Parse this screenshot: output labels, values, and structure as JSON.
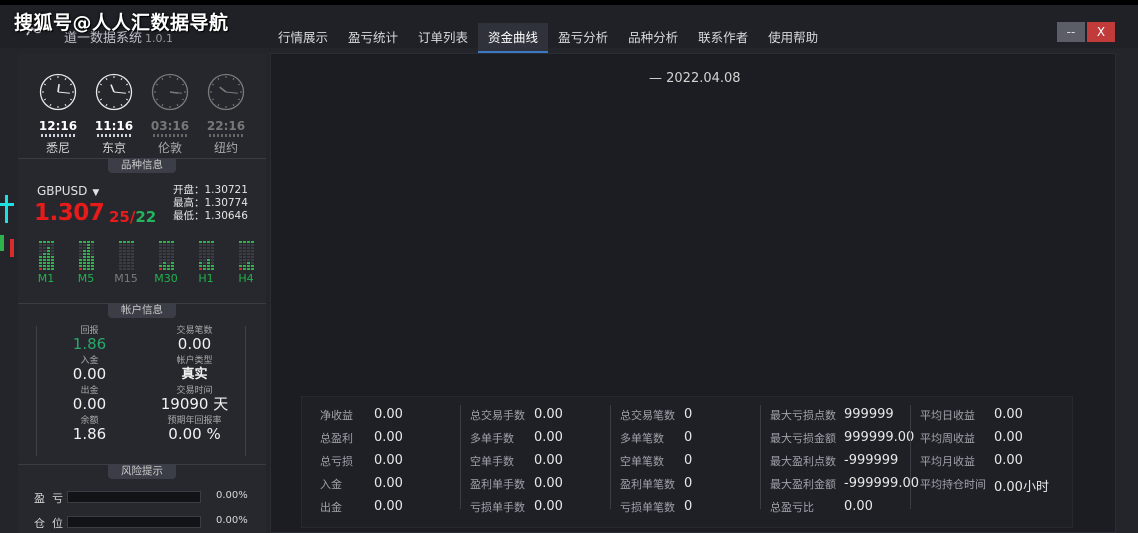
{
  "overlay": {
    "watermark": "搜狐号@人人汇数据导航"
  },
  "app": {
    "title": "道一数据系统",
    "version": "1.0.1"
  },
  "nav": {
    "tabs": [
      "行情展示",
      "盈亏统计",
      "订单列表",
      "资金曲线",
      "盈亏分析",
      "品种分析",
      "联系作者",
      "使用帮助"
    ],
    "active_index": 3
  },
  "window_controls": {
    "minimize": "--",
    "close": "X"
  },
  "clocks": [
    {
      "time": "12:16",
      "city": "悉尼",
      "active": true
    },
    {
      "time": "11:16",
      "city": "东京",
      "active": true
    },
    {
      "time": "03:16",
      "city": "伦敦",
      "active": false
    },
    {
      "time": "22:16",
      "city": "纽约",
      "active": false
    }
  ],
  "symbol": {
    "section_title": "品种信息",
    "name": "GBPUSD",
    "caret": "▼",
    "price_main": "1.307",
    "price_digits_a": "25",
    "price_sep": "/",
    "price_digits_b": "22",
    "open": "开盘：1.30721",
    "high": "最高：1.30774",
    "low": "最低：1.30646",
    "timeframes": [
      {
        "label": "M1",
        "active": true,
        "level": [
          5,
          6,
          8,
          5
        ]
      },
      {
        "label": "M5",
        "active": true,
        "level": [
          4,
          7,
          9,
          5
        ]
      },
      {
        "label": "M15",
        "active": false,
        "level": [
          0,
          0,
          0,
          0
        ]
      },
      {
        "label": "M30",
        "active": true,
        "level": [
          2,
          3,
          2,
          3
        ]
      },
      {
        "label": "H1",
        "active": true,
        "level": [
          3,
          2,
          4,
          2
        ]
      },
      {
        "label": "H4",
        "active": true,
        "level": [
          2,
          2,
          3,
          2
        ]
      }
    ]
  },
  "account": {
    "section_title": "帐户信息",
    "left": [
      {
        "label": "回报",
        "value": "1.86",
        "style": "green"
      },
      {
        "label": "入金",
        "value": "0.00",
        "style": ""
      },
      {
        "label": "出金",
        "value": "0.00",
        "style": ""
      },
      {
        "label": "余额",
        "value": "1.86",
        "style": ""
      }
    ],
    "right": [
      {
        "label": "交易笔数",
        "value": "0.00",
        "style": ""
      },
      {
        "label": "帐户类型",
        "value": "真实",
        "style": "strong"
      },
      {
        "label": "交易时间",
        "value": "19090 天",
        "style": ""
      },
      {
        "label": "预期年回报率",
        "value": "0.00 %",
        "style": ""
      }
    ]
  },
  "risk": {
    "section_title": "风险提示",
    "rows": [
      {
        "label": "盈亏",
        "value": "0.00%",
        "fraction": 0
      },
      {
        "label": "仓位",
        "value": "0.00%",
        "fraction": 0
      }
    ]
  },
  "chart": {
    "legend": "— 2022.04.08"
  },
  "stats": {
    "columns": [
      {
        "rows": [
          {
            "label": "净收益",
            "value": "0.00"
          },
          {
            "label": "总盈利",
            "value": "0.00"
          },
          {
            "label": "总亏损",
            "value": "0.00"
          },
          {
            "label": "入金",
            "value": "0.00"
          },
          {
            "label": "出金",
            "value": "0.00"
          }
        ]
      },
      {
        "rows": [
          {
            "label": "总交易手数",
            "value": "0.00"
          },
          {
            "label": "多单手数",
            "value": "0.00"
          },
          {
            "label": "空单手数",
            "value": "0.00"
          },
          {
            "label": "盈利单手数",
            "value": "0.00"
          },
          {
            "label": "亏损单手数",
            "value": "0.00"
          }
        ]
      },
      {
        "rows": [
          {
            "label": "总交易笔数",
            "value": "0"
          },
          {
            "label": "多单笔数",
            "value": "0"
          },
          {
            "label": "空单笔数",
            "value": "0"
          },
          {
            "label": "盈利单笔数",
            "value": "0"
          },
          {
            "label": "亏损单笔数",
            "value": "0"
          }
        ]
      },
      {
        "rows": [
          {
            "label": "最大亏损点数",
            "value": "999999"
          },
          {
            "label": "最大亏损金额",
            "value": "999999.00"
          },
          {
            "label": "最大盈利点数",
            "value": "-999999"
          },
          {
            "label": "最大盈利金额",
            "value": "-999999.00"
          },
          {
            "label": "总盈亏比",
            "value": "0.00"
          }
        ]
      },
      {
        "rows": [
          {
            "label": "平均日收益",
            "value": "0.00"
          },
          {
            "label": "平均周收益",
            "value": "0.00"
          },
          {
            "label": "平均月收益",
            "value": "0.00"
          },
          {
            "label": "平均持仓时间",
            "value": "0.00小时"
          }
        ]
      }
    ]
  },
  "colors": {
    "accent": "#3b78c4",
    "price_red": "#e81b1b",
    "price_green": "#23b55b",
    "bar_green": "#2fb24c",
    "return_green": "#2aa86a"
  }
}
